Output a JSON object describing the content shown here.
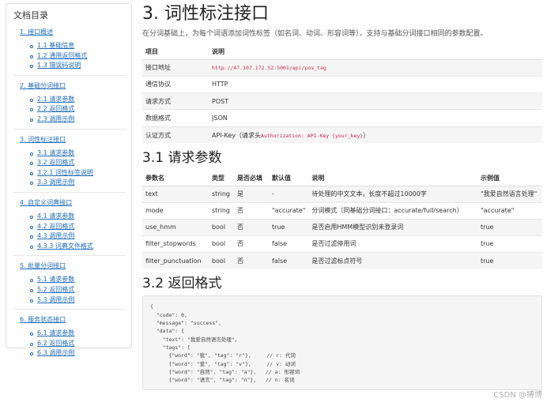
{
  "toc": {
    "title": "文档目录",
    "sections": [
      {
        "label": "1. 接口概述",
        "items": [
          "1.1 基础信息",
          "1.2 通用返回格式",
          "1.3 错误码说明"
        ]
      },
      {
        "label": "2. 基础分词接口",
        "items": [
          "2.1 请求参数",
          "2.2 返回格式",
          "2.3 调用示例"
        ]
      },
      {
        "label": "3. 词性标注接口",
        "items": [
          "3.1 请求参数",
          "3.2 返回格式",
          "3.2.1 词性标签说明",
          "3.3 调用示例"
        ]
      },
      {
        "label": "4. 自定义词典接口",
        "items": [
          "4.1 请求参数",
          "4.2 返回格式",
          "4.3 调用示例",
          "4.3.3 词典文件格式"
        ]
      },
      {
        "label": "5. 批量分词接口",
        "items": [
          "5.1 请求参数",
          "5.2 返回格式",
          "5.3 调用示例"
        ]
      },
      {
        "label": "6. 服务状态接口",
        "items": [
          "6.1 请求参数",
          "6.2 返回格式",
          "6.3 调用示例"
        ]
      }
    ]
  },
  "main": {
    "title": "3. 词性标注接口",
    "intro": "在分词基础上，为每个词语添加词性标签（如名词、动词、形容词等），支持与基础分词接口相同的参数配置。",
    "info_table": {
      "headers": [
        "项目",
        "说明"
      ],
      "rows": [
        {
          "key": "接口地址",
          "value": "http://47.107.172.52:5001/api/pos_tag"
        },
        {
          "key": "通信协议",
          "value": "HTTP"
        },
        {
          "key": "请求方式",
          "value": "POST"
        },
        {
          "key": "数据格式",
          "value": "JSON"
        },
        {
          "key": "认证方式",
          "value_prefix": "API-Key（请求头",
          "value_code": "Authorization: API-Key {your_key}",
          "value_suffix": "）"
        }
      ]
    },
    "params_heading": "3.1 请求参数",
    "params_table": {
      "headers": [
        "参数名",
        "类型",
        "是否必填",
        "默认值",
        "说明",
        "示例值"
      ],
      "rows": [
        [
          "text",
          "string",
          "是",
          "-",
          "待处理的中文文本，长度不超过10000字",
          "\"我爱自然语言处理\""
        ],
        [
          "mode",
          "string",
          "否",
          "\"accurate\"",
          "分词模式（同基础分词接口：accurate/full/search）",
          "\"accurate\""
        ],
        [
          "use_hmm",
          "bool",
          "否",
          "true",
          "是否启用HMM模型识别未登录词",
          "true"
        ],
        [
          "filter_stopwords",
          "bool",
          "否",
          "false",
          "是否过滤停用词",
          "true"
        ],
        [
          "filter_punctuation",
          "bool",
          "否",
          "false",
          "是否过滤标点符号",
          "true"
        ]
      ]
    },
    "response_heading": "3.2 返回格式",
    "code": "{\n  \"code\": 0,\n  \"message\": \"success\",\n  \"data\": {\n    \"text\": \"我爱自然语言处理\",\n    \"tags\": [\n      {\"word\": \"我\", \"tag\": \"r\"},     // r: 代词\n      {\"word\": \"爱\", \"tag\": \"v\"},     // v: 动词\n      {\"word\": \"自然\", \"tag\": \"a\"},   // a: 形容词\n      {\"word\": \"语言\", \"tag\": \"n\"},   // n: 名词"
  },
  "watermark": "CSDN @搏博"
}
